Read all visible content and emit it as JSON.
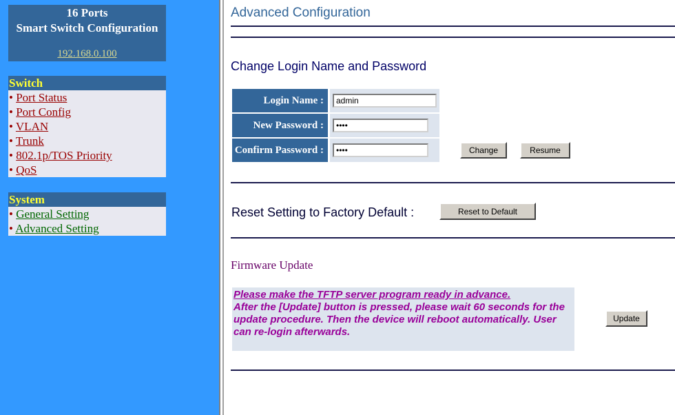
{
  "left": {
    "title_line1": "16 Ports",
    "title_line2": "Smart Switch Configuration",
    "ip": "192.168.0.100",
    "switch_menu": {
      "heading": "Switch",
      "items": [
        "Port Status",
        "Port Config",
        "VLAN",
        "Trunk",
        "802.1p/TOS Priority",
        "QoS"
      ]
    },
    "system_menu": {
      "heading": "System",
      "items": [
        "General Setting",
        "Advanced Setting"
      ]
    },
    "bullet": "•"
  },
  "main": {
    "page_title": "Advanced Configuration",
    "login_section": {
      "heading": "Change Login Name and Password",
      "login_name_label": "Login Name :",
      "login_name_value": "admin",
      "new_password_label": "New Password :",
      "new_password_value": "1234",
      "confirm_password_label": "Confirm Password :",
      "confirm_password_value": "1234",
      "change_button": "Change",
      "resume_button": "Resume"
    },
    "reset_section": {
      "label": "Reset Setting to Factory Default :",
      "button": "Reset to Default"
    },
    "firmware_section": {
      "heading": "Firmware Update",
      "note_line1": "Please make the TFTP server program ready in advance.",
      "note_rest": "After the [Update] button is pressed, please wait 60 seconds for the update procedure. Then the device will reboot automatically. User can re-login afterwards.",
      "update_button": "Update"
    }
  },
  "colors": {
    "left_background": "#3399ff",
    "menu_header": "#336699",
    "menu_heading_text": "#ffff33",
    "switch_link": "#990000",
    "system_link": "#006600",
    "note_text": "#990099"
  }
}
